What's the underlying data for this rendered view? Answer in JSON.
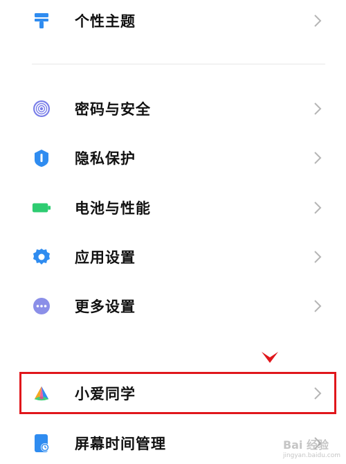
{
  "settings": {
    "items": [
      {
        "label": "个性主题",
        "icon": "brush-icon"
      },
      {
        "label": "密码与安全",
        "icon": "fingerprint-icon"
      },
      {
        "label": "隐私保护",
        "icon": "shield-icon"
      },
      {
        "label": "电池与性能",
        "icon": "battery-icon"
      },
      {
        "label": "应用设置",
        "icon": "gear-icon"
      },
      {
        "label": "更多设置",
        "icon": "more-icon"
      },
      {
        "label": "小爱同学",
        "icon": "xiaoai-icon"
      },
      {
        "label": "屏幕时间管理",
        "icon": "screen-time-icon"
      }
    ]
  },
  "watermark": {
    "text": "Bai 经验",
    "sub": "jingyan.baidu.com"
  },
  "colors": {
    "accent_blue": "#2f8cf0",
    "battery_green": "#2ecc71",
    "highlight_red": "#e0161b"
  }
}
